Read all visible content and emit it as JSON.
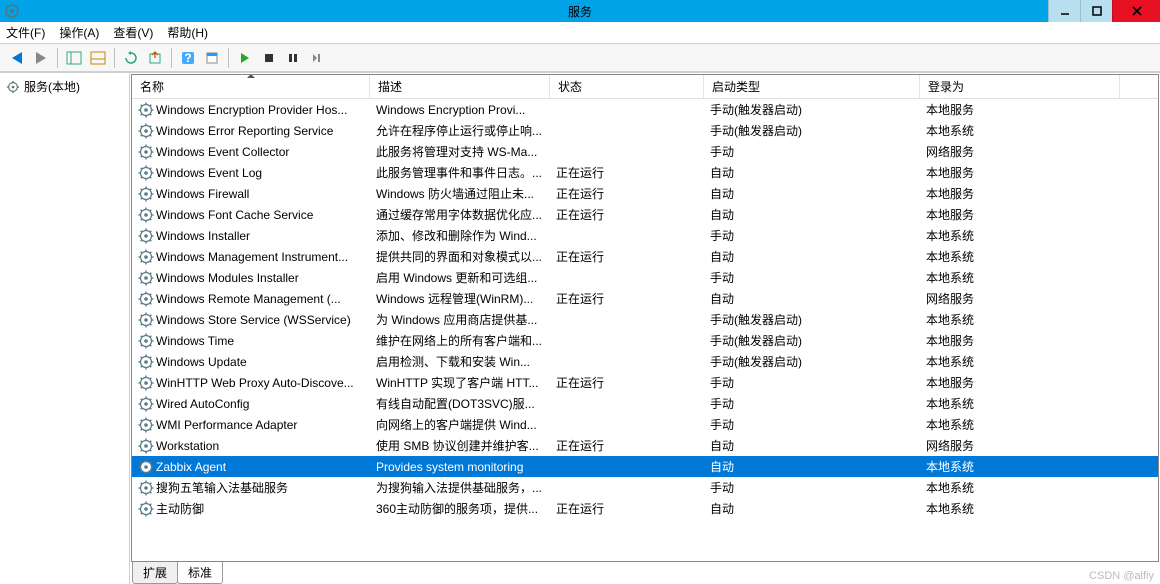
{
  "window": {
    "title": "服务"
  },
  "menu": {
    "file": "文件(F)",
    "action": "操作(A)",
    "view": "查看(V)",
    "help": "帮助(H)"
  },
  "tree": {
    "root": "服务(本地)"
  },
  "columns": {
    "name": "名称",
    "desc": "描述",
    "status": "状态",
    "start": "启动类型",
    "logon": "登录为"
  },
  "tabs": {
    "extended": "扩展",
    "standard": "标准"
  },
  "watermark": "CSDN @alfiy",
  "services": [
    {
      "name": "Windows Encryption Provider Hos...",
      "desc": "Windows Encryption Provi...",
      "status": "",
      "start": "手动(触发器启动)",
      "logon": "本地服务"
    },
    {
      "name": "Windows Error Reporting Service",
      "desc": "允许在程序停止运行或停止响...",
      "status": "",
      "start": "手动(触发器启动)",
      "logon": "本地系统"
    },
    {
      "name": "Windows Event Collector",
      "desc": "此服务将管理对支持 WS-Ma...",
      "status": "",
      "start": "手动",
      "logon": "网络服务"
    },
    {
      "name": "Windows Event Log",
      "desc": "此服务管理事件和事件日志。...",
      "status": "正在运行",
      "start": "自动",
      "logon": "本地服务"
    },
    {
      "name": "Windows Firewall",
      "desc": "Windows 防火墙通过阻止未...",
      "status": "正在运行",
      "start": "自动",
      "logon": "本地服务"
    },
    {
      "name": "Windows Font Cache Service",
      "desc": "通过缓存常用字体数据优化应...",
      "status": "正在运行",
      "start": "自动",
      "logon": "本地服务"
    },
    {
      "name": "Windows Installer",
      "desc": "添加、修改和删除作为 Wind...",
      "status": "",
      "start": "手动",
      "logon": "本地系统"
    },
    {
      "name": "Windows Management Instrument...",
      "desc": "提供共同的界面和对象模式以...",
      "status": "正在运行",
      "start": "自动",
      "logon": "本地系统"
    },
    {
      "name": "Windows Modules Installer",
      "desc": "启用 Windows 更新和可选组...",
      "status": "",
      "start": "手动",
      "logon": "本地系统"
    },
    {
      "name": "Windows Remote Management (...",
      "desc": "Windows 远程管理(WinRM)...",
      "status": "正在运行",
      "start": "自动",
      "logon": "网络服务"
    },
    {
      "name": "Windows Store Service (WSService)",
      "desc": "为 Windows 应用商店提供基...",
      "status": "",
      "start": "手动(触发器启动)",
      "logon": "本地系统"
    },
    {
      "name": "Windows Time",
      "desc": "维护在网络上的所有客户端和...",
      "status": "",
      "start": "手动(触发器启动)",
      "logon": "本地服务"
    },
    {
      "name": "Windows Update",
      "desc": "启用检测、下载和安装 Win...",
      "status": "",
      "start": "手动(触发器启动)",
      "logon": "本地系统"
    },
    {
      "name": "WinHTTP Web Proxy Auto-Discove...",
      "desc": "WinHTTP 实现了客户端 HTT...",
      "status": "正在运行",
      "start": "手动",
      "logon": "本地服务"
    },
    {
      "name": "Wired AutoConfig",
      "desc": "有线自动配置(DOT3SVC)服...",
      "status": "",
      "start": "手动",
      "logon": "本地系统"
    },
    {
      "name": "WMI Performance Adapter",
      "desc": "向网络上的客户端提供 Wind...",
      "status": "",
      "start": "手动",
      "logon": "本地系统"
    },
    {
      "name": "Workstation",
      "desc": "使用 SMB 协议创建并维护客...",
      "status": "正在运行",
      "start": "自动",
      "logon": "网络服务"
    },
    {
      "name": "Zabbix Agent",
      "desc": "Provides system monitoring",
      "status": "",
      "start": "自动",
      "logon": "本地系统",
      "selected": true
    },
    {
      "name": "搜狗五笔输入法基础服务",
      "desc": "为搜狗输入法提供基础服务，...",
      "status": "",
      "start": "手动",
      "logon": "本地系统"
    },
    {
      "name": "主动防御",
      "desc": "360主动防御的服务项，提供...",
      "status": "正在运行",
      "start": "自动",
      "logon": "本地系统"
    }
  ]
}
